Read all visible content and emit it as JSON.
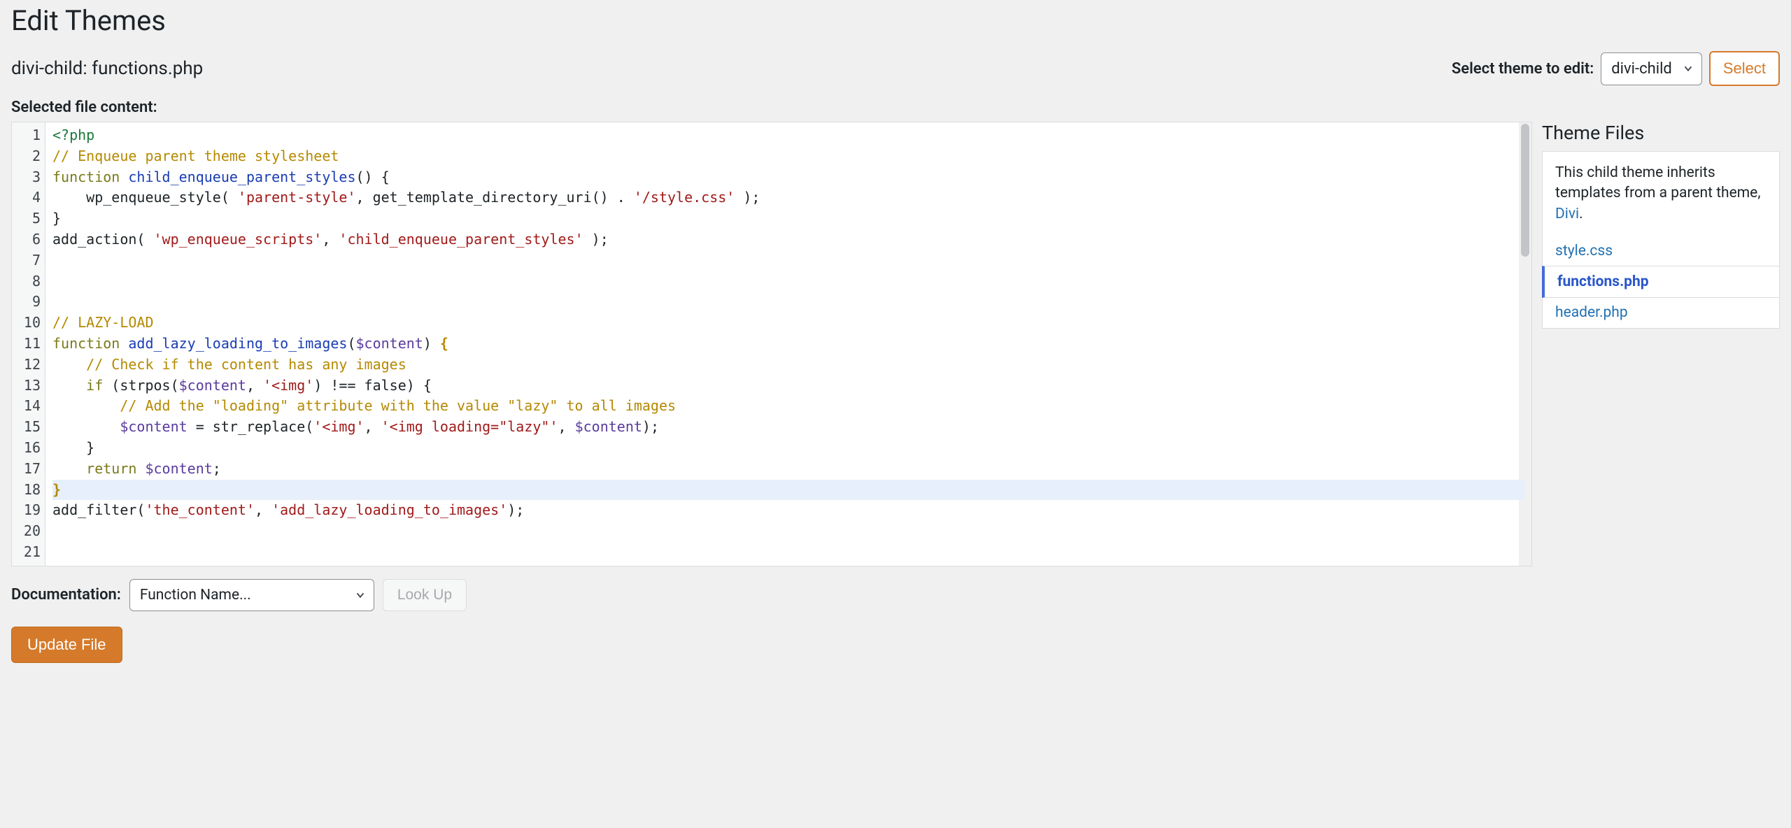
{
  "page_title": "Edit Themes",
  "file_title": "divi-child: functions.php",
  "select_theme_label": "Select theme to edit:",
  "select_theme_value": "divi-child",
  "select_button": "Select",
  "selected_file_content_label": "Selected file content:",
  "theme_files_heading": "Theme Files",
  "inherit_note_pre": "This child theme inherits templates from a parent theme, ",
  "inherit_note_link": "Divi",
  "inherit_note_post": ".",
  "theme_files": {
    "f0": "style.css",
    "f1": "functions.php",
    "f2": "header.php"
  },
  "doc_label": "Documentation:",
  "doc_select_value": "Function Name...",
  "lookup_button": "Look Up",
  "update_button": "Update File",
  "line_numbers": [
    "1",
    "2",
    "3",
    "4",
    "5",
    "6",
    "7",
    "8",
    "9",
    "10",
    "11",
    "12",
    "13",
    "14",
    "15",
    "16",
    "17",
    "18",
    "19",
    "20",
    "21"
  ],
  "code": {
    "l1a": "<?php",
    "l2a": "// Enqueue parent theme stylesheet",
    "l3a": "function",
    "l3b": " ",
    "l3c": "child_enqueue_parent_styles",
    "l3d": "() {",
    "l4a": "    wp_enqueue_style( ",
    "l4b": "'parent-style'",
    "l4c": ", get_template_directory_uri() . ",
    "l4d": "'/style.css'",
    "l4e": " );",
    "l5a": "}",
    "l6a": "add_action( ",
    "l6b": "'wp_enqueue_scripts'",
    "l6c": ", ",
    "l6d": "'child_enqueue_parent_styles'",
    "l6e": " );",
    "l10a": "// LAZY-LOAD",
    "l11a": "function",
    "l11b": " ",
    "l11c": "add_lazy_loading_to_images",
    "l11d": "(",
    "l11e": "$content",
    "l11f": ") ",
    "l11g": "{",
    "l12a": "    ",
    "l12b": "// Check if the content has any images",
    "l13a": "    ",
    "l13b": "if",
    "l13c": " (strpos(",
    "l13d": "$content",
    "l13e": ", ",
    "l13f": "'<img'",
    "l13g": ") !== false) {",
    "l14a": "        ",
    "l14b": "// Add the \"loading\" attribute with the value \"lazy\" to all images",
    "l15a": "        ",
    "l15b": "$content",
    "l15c": " = str_replace(",
    "l15d": "'<img'",
    "l15e": ", ",
    "l15f": "'<img loading=\"lazy\"'",
    "l15g": ", ",
    "l15h": "$content",
    "l15i": ");",
    "l16a": "    }",
    "l17a": "    ",
    "l17b": "return",
    "l17c": " ",
    "l17d": "$content",
    "l17e": ";",
    "l18a": "}",
    "l19a": "add_filter(",
    "l19b": "'the_content'",
    "l19c": ", ",
    "l19d": "'add_lazy_loading_to_images'",
    "l19e": ");"
  }
}
